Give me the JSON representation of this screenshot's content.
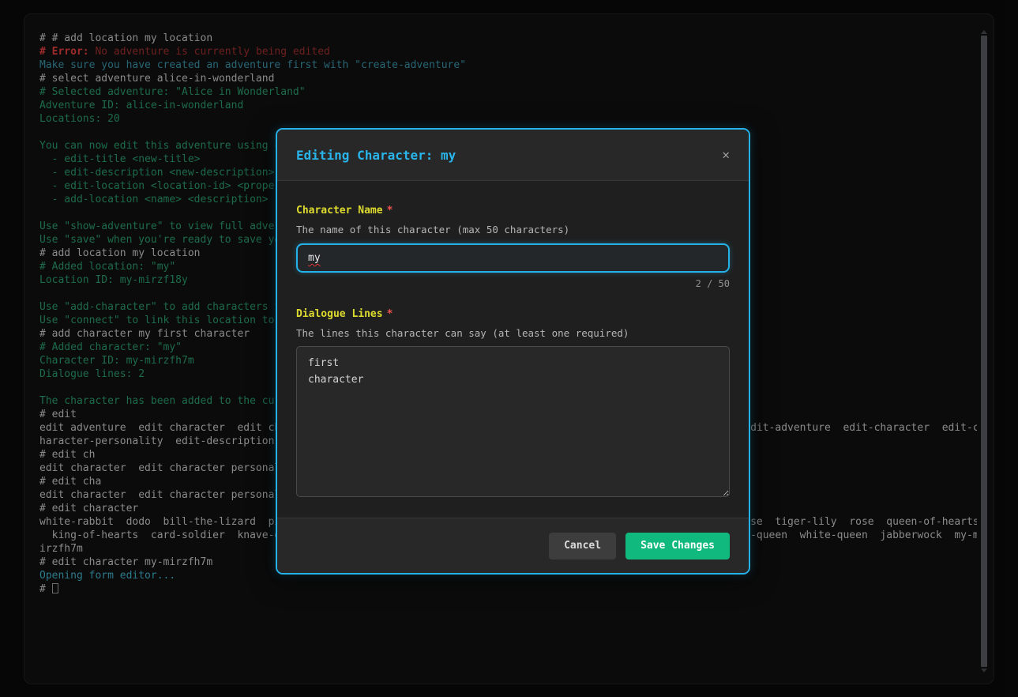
{
  "colors": {
    "accent_cyan": "#29b5ea",
    "save_green": "#10b97d",
    "label_yellow": "#dedb2f",
    "required_red": "#ef5350",
    "error_red": "#f34242",
    "terminal_green": "#2da575",
    "terminal_teal": "#3f9db4"
  },
  "terminal": {
    "lines": [
      [
        {
          "t": "# # add location my location",
          "c": "cmd"
        }
      ],
      [
        {
          "t": "# Error:",
          "c": "err-bold"
        },
        {
          "t": " No adventure is currently being edited",
          "c": "err"
        }
      ],
      [
        {
          "t": "Make sure you have created an adventure first with \"create-adventure\"",
          "c": "teal"
        }
      ],
      [
        {
          "t": "# select adventure alice-in-wonderland",
          "c": "cmd"
        }
      ],
      [
        {
          "t": "# Selected adventure: \"Alice in Wonderland\"",
          "c": "green"
        }
      ],
      [
        {
          "t": "Adventure ID: alice-in-wonderland",
          "c": "green"
        }
      ],
      [
        {
          "t": "Locations: 20",
          "c": "green"
        }
      ],
      [],
      [
        {
          "t": "You can now edit this adventure using c",
          "c": "green"
        }
      ],
      [
        {
          "t": "  - edit-title <new-title>",
          "c": "green"
        }
      ],
      [
        {
          "t": "  - edit-description <new-description>",
          "c": "green"
        }
      ],
      [
        {
          "t": "  - edit-location <location-id> <proper",
          "c": "green"
        }
      ],
      [
        {
          "t": "  - add-location <name> <description>",
          "c": "green"
        }
      ],
      [],
      [
        {
          "t": "Use \"show-adventure\" to view full adver",
          "c": "green"
        }
      ],
      [
        {
          "t": "Use \"save\" when you're ready to save yo",
          "c": "green"
        }
      ],
      [
        {
          "t": "# add location my location",
          "c": "cmd"
        }
      ],
      [
        {
          "t": "# Added location: \"my\"",
          "c": "green"
        }
      ],
      [
        {
          "t": "Location ID: my-mirzf18y",
          "c": "green"
        }
      ],
      [],
      [
        {
          "t": "Use \"add-character\" to add characters t",
          "c": "green"
        }
      ],
      [
        {
          "t": "Use \"connect\" to link this location to ",
          "c": "green"
        }
      ],
      [
        {
          "t": "# add character my first character",
          "c": "cmd"
        }
      ],
      [
        {
          "t": "# Added character: \"my\"",
          "c": "green"
        }
      ],
      [
        {
          "t": "Character ID: my-mirzfh7m",
          "c": "green"
        }
      ],
      [
        {
          "t": "Dialogue lines: 2",
          "c": "green"
        }
      ],
      [],
      [
        {
          "t": "The character has been added to the cur",
          "c": "green"
        }
      ],
      [
        {
          "t": "# edit",
          "c": "cmd"
        }
      ],
      [
        {
          "t": "edit adventure  edit character  edit ch",
          "c": "cmd"
        },
        {
          "t": "dit-adventure  edit-character  edit-c",
          "c": "cmd",
          "col": 115
        }
      ],
      [
        {
          "t": "haracter-personality  edit-description ",
          "c": "cmd"
        }
      ],
      [
        {
          "t": "# edit ch",
          "c": "cmd"
        }
      ],
      [
        {
          "t": "edit character  edit character personal",
          "c": "cmd"
        }
      ],
      [
        {
          "t": "# edit cha",
          "c": "cmd"
        }
      ],
      [
        {
          "t": "edit character  edit character personal",
          "c": "cmd"
        }
      ],
      [
        {
          "t": "# edit character",
          "c": "cmd"
        }
      ],
      [
        {
          "t": "white-rabbit  dodo  bill-the-lizard  pi",
          "c": "cmd"
        },
        {
          "t": "se  tiger-lily  rose  queen-of-hearts",
          "c": "cmd",
          "col": 115
        }
      ],
      [
        {
          "t": "  king-of-hearts  card-soldier  knave-o",
          "c": "cmd"
        },
        {
          "t": "-queen  white-queen  jabberwock  my-m",
          "c": "cmd",
          "col": 115
        }
      ],
      [
        {
          "t": "irzfh7m",
          "c": "cmd"
        }
      ],
      [
        {
          "t": "# edit character my-mirzfh7m",
          "c": "cmd"
        }
      ],
      [
        {
          "t": "Opening form editor...",
          "c": "cyan"
        }
      ],
      [
        {
          "t": "# ",
          "c": "cmd"
        },
        {
          "t": "",
          "c": "cursor"
        }
      ]
    ]
  },
  "modal": {
    "title": "Editing Character: my",
    "close_icon": "✕",
    "required_marker": "*",
    "name_field": {
      "label": "Character Name",
      "help": "The name of this character (max 50 characters)",
      "value": "my",
      "counter": "2 / 50"
    },
    "dialogue_field": {
      "label": "Dialogue Lines",
      "help": "The lines this character can say (at least one required)",
      "value": "first\ncharacter"
    },
    "cancel_label": "Cancel",
    "save_label": "Save Changes"
  }
}
